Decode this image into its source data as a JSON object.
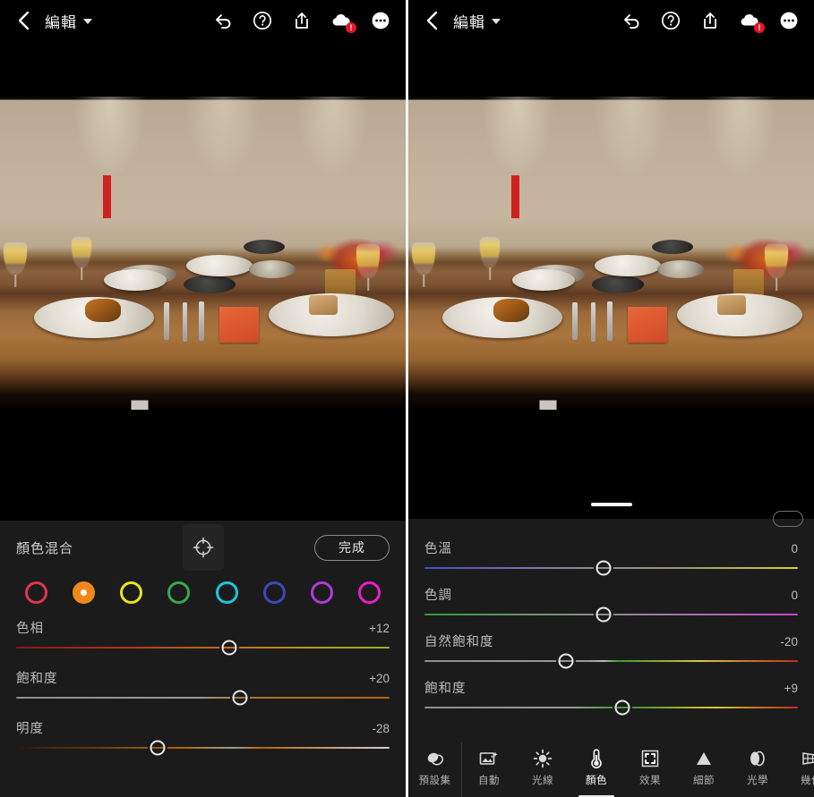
{
  "app": {
    "header": {
      "title": "編輯",
      "back_icon": "back-chevron-icon",
      "caret_icon": "chevron-down-icon",
      "actions": [
        {
          "name": "undo-icon",
          "label": "復原"
        },
        {
          "name": "help-icon",
          "label": "說明"
        },
        {
          "name": "share-icon",
          "label": "分享"
        },
        {
          "name": "cloud-sync-icon",
          "label": "雲端",
          "badge": "!"
        },
        {
          "name": "more-options-icon",
          "label": "更多"
        }
      ]
    }
  },
  "left_screen": {
    "panel": {
      "title": "顏色混合",
      "target_icon": "target-adjust-icon",
      "done_label": "完成",
      "swatches": [
        {
          "name": "swatch-red",
          "color": "#e0364a",
          "selected": false
        },
        {
          "name": "swatch-orange",
          "color": "#f0881c",
          "selected": true
        },
        {
          "name": "swatch-yellow",
          "color": "#ece31c",
          "selected": false
        },
        {
          "name": "swatch-green",
          "color": "#3aa84c",
          "selected": false
        },
        {
          "name": "swatch-aqua",
          "color": "#1ec6d8",
          "selected": false
        },
        {
          "name": "swatch-blue",
          "color": "#3a4ab8",
          "selected": false
        },
        {
          "name": "swatch-purple",
          "color": "#b03ad8",
          "selected": false
        },
        {
          "name": "swatch-magenta",
          "color": "#e81cc8",
          "selected": false
        }
      ],
      "sliders": [
        {
          "name": "hue-slider",
          "label": "色相",
          "value": "+12",
          "pos": 57,
          "gradient": "linear-gradient(to right, #8a1414 0%, #b03a12 30%, #c96a18 55%, #b59a20 78%, #9ab030 100%)"
        },
        {
          "name": "saturation-slider",
          "label": "飽和度",
          "value": "+20",
          "pos": 60,
          "gradient": "linear-gradient(to right, #8e8e8e 0%, #9a9a9a 48%, #a8762a 62%, #b4650f 100%)"
        },
        {
          "name": "luminance-slider",
          "label": "明度",
          "value": "-28",
          "pos": 38,
          "gradient": "linear-gradient(to right, #2a1708 0%, #6a3c12 22%, #b4650f 45%, #9a9a9a 58%, #b4650f 66%, #cfcfcf 100%)"
        }
      ]
    }
  },
  "right_screen": {
    "panel": {
      "sliders": [
        {
          "name": "temperature-slider",
          "label": "色溫",
          "value": "0",
          "pos": 48,
          "gradient": "linear-gradient(to right, #4a4ad0 0%, #7a7aa8 30%, #8c8c8c 48%, #9a9670 70%, #d8d040 100%)"
        },
        {
          "name": "tint-slider",
          "label": "色調",
          "value": "0",
          "pos": 48,
          "gradient": "linear-gradient(to right, #2f9a3a 0%, #6f9070 28%, #8c8c8c 48%, #a870b0 72%, #d040c8 100%)"
        },
        {
          "name": "vibrance-slider",
          "label": "自然飽和度",
          "value": "-20",
          "pos": 38,
          "gradient": "linear-gradient(to right, #8e8e8e 0%, #9a9a9a 44%, #b8b8b8 48%, #3a9a3a 52%, #8aa82a 62%, #d8c83a 74%, #c87a20 86%, #c03020 100%)"
        },
        {
          "name": "saturation-slider",
          "label": "飽和度",
          "value": "+9",
          "pos": 53,
          "gradient": "linear-gradient(to right, #8e8e8e 0%, #9a9a9a 40%, #4a9a3a 50%, #3a9a3a 56%, #8aa82a 66%, #d8c83a 78%, #c87a20 88%, #c03020 100%)"
        }
      ],
      "toolbar": [
        {
          "name": "tab-presets",
          "label": "預設集",
          "icon": "presets-icon",
          "active": false
        },
        {
          "name": "tab-auto",
          "label": "自動",
          "icon": "auto-icon",
          "active": false
        },
        {
          "name": "tab-light",
          "label": "光線",
          "icon": "sun-icon",
          "active": false
        },
        {
          "name": "tab-color",
          "label": "顏色",
          "icon": "thermometer-icon",
          "active": true
        },
        {
          "name": "tab-effects",
          "label": "效果",
          "icon": "effects-icon",
          "active": false
        },
        {
          "name": "tab-detail",
          "label": "細節",
          "icon": "triangle-icon",
          "active": false
        },
        {
          "name": "tab-optics",
          "label": "光學",
          "icon": "lens-icon",
          "active": false
        },
        {
          "name": "tab-geometry",
          "label": "幾何",
          "icon": "perspective-grid-icon",
          "active": false
        }
      ]
    }
  },
  "photo": {
    "description": "餐廳餐桌照片"
  }
}
